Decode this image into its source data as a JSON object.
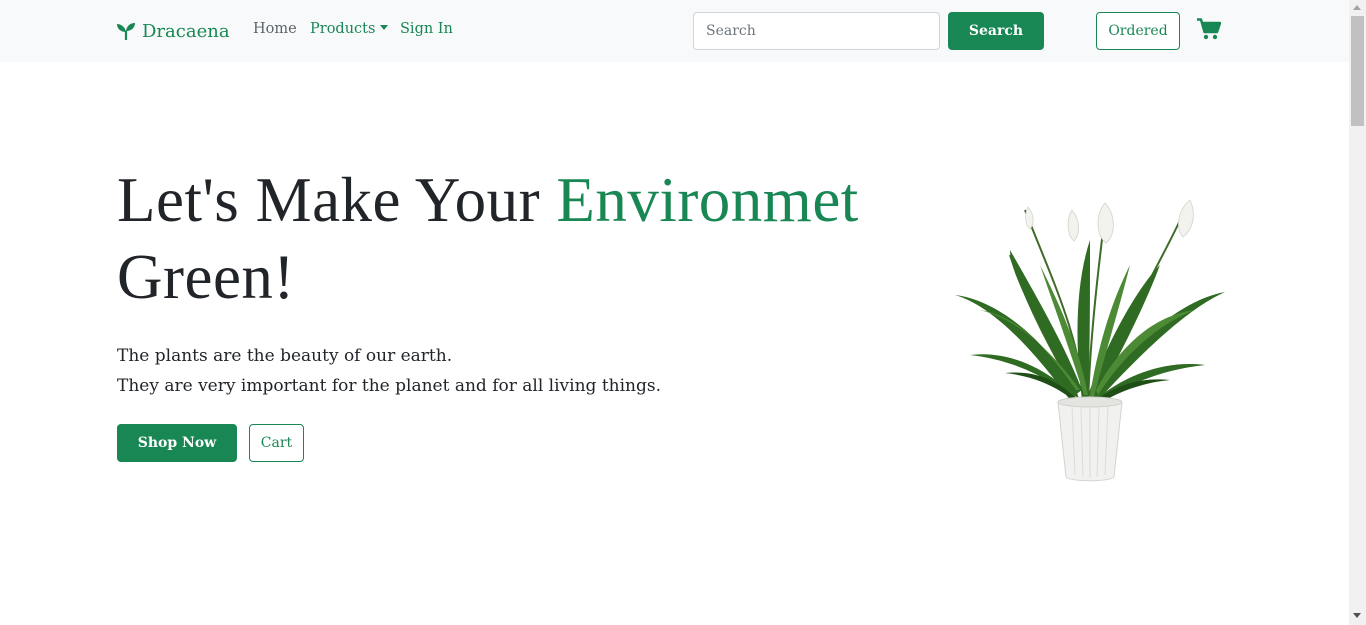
{
  "nav": {
    "brand": "Dracaena",
    "links": {
      "home": "Home",
      "products": "Products",
      "signin": "Sign In"
    },
    "search_placeholder": "Search",
    "search_button": "Search",
    "ordered_button": "Ordered",
    "cart_icon": "shopping-cart-icon",
    "brand_icon": "sprout-icon"
  },
  "hero": {
    "title_part1": "Let's Make Your ",
    "title_accent": "Environmet",
    "title_part2": "Green!",
    "line1": "The plants are the beauty of our earth.",
    "line2": "They are very important for the planet and for all living things.",
    "shop_button": "Shop Now",
    "cart_button": "Cart"
  },
  "colors": {
    "accent": "#198754",
    "navbar_bg": "#f8f9fa",
    "text": "#212529"
  }
}
